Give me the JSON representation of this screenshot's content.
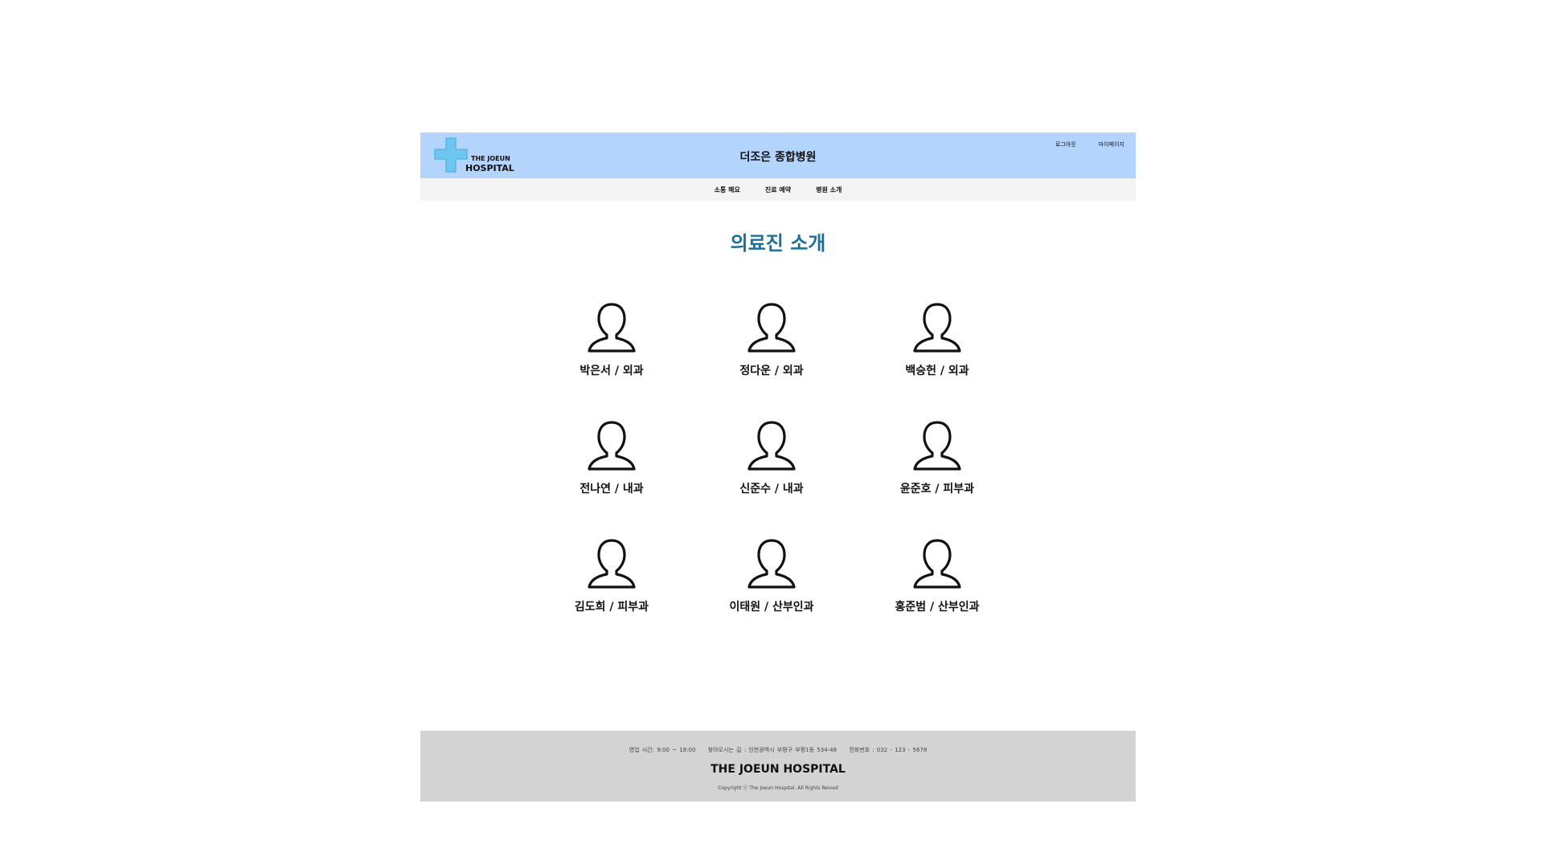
{
  "header": {
    "logo_line1": "THE JOEUN",
    "logo_line2": "HOSPITAL",
    "title": "더조은 종합병원",
    "links": {
      "logout": "로그아웃",
      "mypage": "마이페이지"
    },
    "colors": {
      "header_bg": "#b3d4fc",
      "logo_cross": "#6ec6f0"
    }
  },
  "nav": {
    "items": [
      "소통 해요",
      "진료 예약",
      "병원 소개"
    ]
  },
  "main": {
    "title": "의료진 소개",
    "title_color": "#1d6f9a",
    "doctors": [
      {
        "name": "박은서 / 외과",
        "icon": "person-icon"
      },
      {
        "name": "정다운 / 외과",
        "icon": "person-icon"
      },
      {
        "name": "백승헌 / 외과",
        "icon": "person-icon"
      },
      {
        "name": "전나연 / 내과",
        "icon": "person-icon"
      },
      {
        "name": "신준수 / 내과",
        "icon": "person-icon"
      },
      {
        "name": "윤준호 / 피부과",
        "icon": "person-icon"
      },
      {
        "name": "김도희 / 피부과",
        "icon": "person-icon"
      },
      {
        "name": "이태원 / 산부인과",
        "icon": "person-icon"
      },
      {
        "name": "홍준범 / 산부인과",
        "icon": "person-icon"
      }
    ]
  },
  "footer": {
    "hours": "영업 시간: 9:00 ~ 18:00",
    "address": "찾아오시는 길 : 인천광역시 부평구 부평1동 534-48",
    "phone": "전화번호 : 032 - 123 - 5678",
    "brand": "THE JOEUN HOSPITAL",
    "copyright": "Copyright ⓒ The Joeun Hospital. All Rights Reived"
  }
}
